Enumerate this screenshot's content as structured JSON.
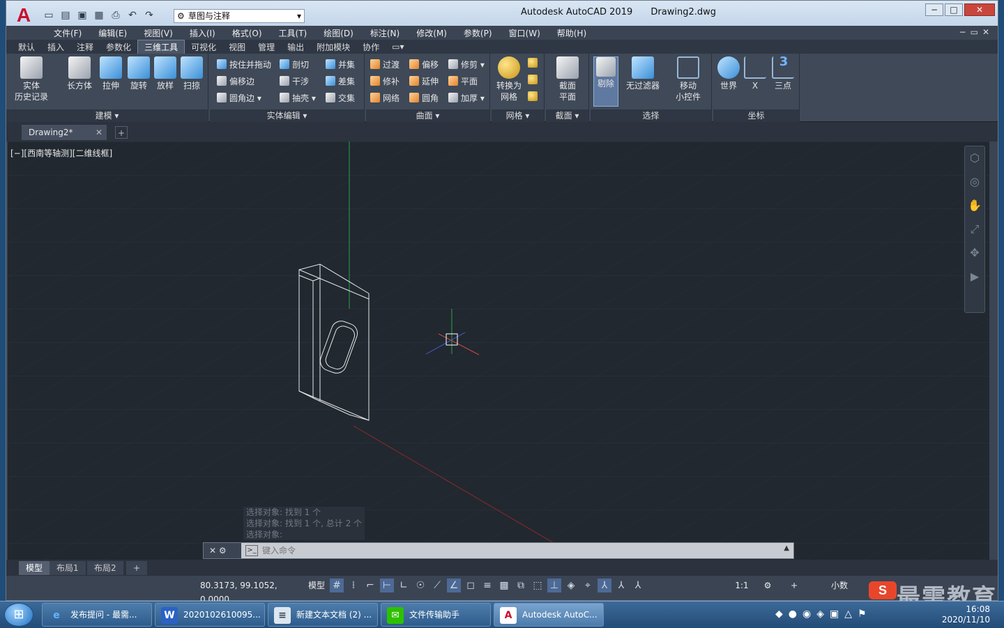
{
  "app": {
    "title": "Autodesk AutoCAD 2019",
    "file": "Drawing2.dwg",
    "logo": "A"
  },
  "workspace": "草图与注释",
  "menu": [
    "文件(F)",
    "编辑(E)",
    "视图(V)",
    "插入(I)",
    "格式(O)",
    "工具(T)",
    "绘图(D)",
    "标注(N)",
    "修改(M)",
    "参数(P)",
    "窗口(W)",
    "帮助(H)"
  ],
  "ribbon_tabs": [
    "默认",
    "插入",
    "注释",
    "参数化",
    "三维工具",
    "可视化",
    "视图",
    "管理",
    "输出",
    "附加模块",
    "协作"
  ],
  "active_tab": "三维工具",
  "panels": {
    "model": {
      "label": "建模 ▾",
      "buttons": [
        "实体\n历史记录",
        "长方体",
        "拉伸",
        "旋转",
        "放样",
        "扫掠"
      ]
    },
    "solid_edit": {
      "label": "实体编辑 ▾",
      "items": [
        "按住并拖动",
        "剖切",
        "并集",
        "偏移边",
        "干涉",
        "差集",
        "圆角边 ▾",
        "抽壳 ▾",
        "交集"
      ]
    },
    "surface": {
      "label": "曲面 ▾",
      "items": [
        "过渡",
        "偏移",
        "修剪 ▾",
        "修补",
        "延伸",
        "平面",
        "网络",
        "圆角",
        "加厚 ▾"
      ]
    },
    "mesh": {
      "label": "网格 ▾",
      "button": "转换为\n网格"
    },
    "section": {
      "label": "截面 ▾",
      "button": "截面\n平面"
    },
    "selection": {
      "label": "选择",
      "buttons": [
        "剔除",
        "无过滤器",
        "移动\n小控件"
      ]
    },
    "coords": {
      "label": "坐标",
      "buttons": [
        "世界",
        "X",
        "三点"
      ]
    }
  },
  "doc_tab": "Drawing2*",
  "viewport_label": "[−][西南等轴测][二维线框]",
  "command_history": [
    "选择对象: 找到 1 个",
    "选择对象: 找到 1 个, 总计 2 个",
    "选择对象:"
  ],
  "command_placeholder": "键入命令",
  "layout_tabs": [
    "模型",
    "布局1",
    "布局2"
  ],
  "status": {
    "coords": "80.3173, 99.1052, 0.0000",
    "mode": "模型",
    "scale": "1:1",
    "units": "小数"
  },
  "taskbar": [
    {
      "label": "发布提问 - 最需...",
      "icon": "e"
    },
    {
      "label": "2020102610095...",
      "icon": "W"
    },
    {
      "label": "新建文本文档 (2) ...",
      "icon": "≡"
    },
    {
      "label": "文件传输助手",
      "icon": "✉"
    },
    {
      "label": "Autodesk AutoC...",
      "icon": "A"
    }
  ],
  "clock": {
    "time": "16:08",
    "date": "2020/11/10"
  },
  "watermark": "最需教育",
  "colors": {
    "canvas": "#212830",
    "accent": "#c8102e",
    "ucs_x": "#c83232",
    "ucs_y": "#2ea043"
  }
}
